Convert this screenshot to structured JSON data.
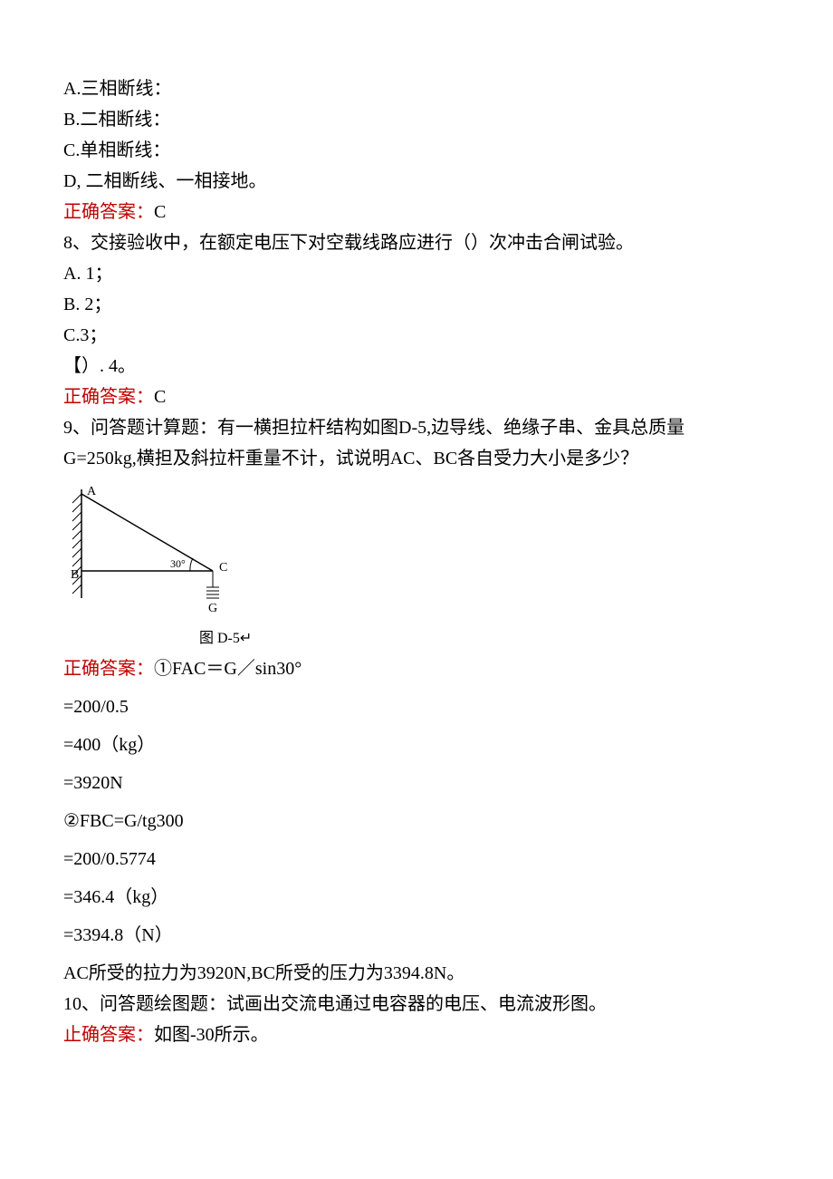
{
  "q7": {
    "optA": "A.三相断线：",
    "optB": "B.二相断线：",
    "optC": "C.单相断线：",
    "optD": "D, 二相断线、一相接地。",
    "answer_label": "正确答案：",
    "answer_value": "C"
  },
  "q8": {
    "stem": "8、交接验收中，在额定电压下对空载线路应进行（）次冲击合闸试验。",
    "optA": "A.  1；",
    "optB": "B.  2；",
    "optC": "C.3；",
    "optD": "【）. 4。",
    "answer_label": "正确答案：",
    "answer_value": "C"
  },
  "q9": {
    "stem1": "9、问答题计算题：有一横担拉杆结构如图D-5,边导线、绝缘子串、金具总质量",
    "stem2": "G=250kg,横担及斜拉杆重量不计，试说明AC、BC各自受力大小是多少？",
    "fig_caption": "图 D-5↵",
    "answer_label": "正确答案：",
    "answer_line1": "①FAC＝G／sin30°",
    "calc1": "=200/0.5",
    "calc2": "=400（kg）",
    "calc3": "=3920N",
    "calc4": "②FBC=G/tg300",
    "calc5": "=200/0.5774",
    "calc6": "=346.4（kg）",
    "calc7": "=3394.8（N）",
    "conclusion": "AC所受的拉力为3920N,BC所受的压力为3394.8N。"
  },
  "q10": {
    "stem": "10、问答题绘图题：试画出交流电通过电容器的电压、电流波形图。",
    "answer_label": "止确答案：",
    "answer_value": "如图-30所示。"
  },
  "diagram": {
    "labelA": "A",
    "labelB": "B",
    "labelC": "C",
    "labelG": "G",
    "angle": "30°"
  }
}
